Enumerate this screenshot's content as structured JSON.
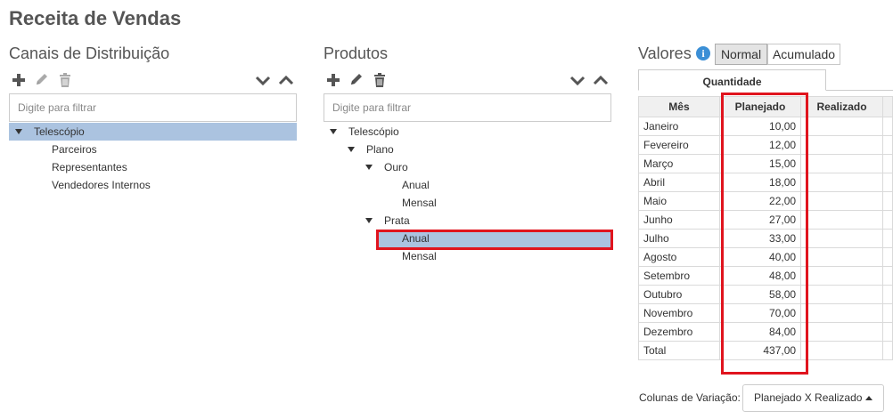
{
  "page": {
    "title": "Receita de Vendas"
  },
  "channels": {
    "title": "Canais de Distribuição",
    "filter_placeholder": "Digite para filtrar",
    "tree": [
      {
        "label": "Telescópio",
        "expanded": true,
        "selected": true
      },
      {
        "label": "Parceiros"
      },
      {
        "label": "Representantes"
      },
      {
        "label": "Vendedores Internos"
      }
    ]
  },
  "products": {
    "title": "Produtos",
    "filter_placeholder": "Digite para filtrar",
    "tree": [
      {
        "label": "Telescópio",
        "expanded": true
      },
      {
        "label": "Plano",
        "expanded": true
      },
      {
        "label": "Ouro",
        "expanded": true
      },
      {
        "label": "Anual"
      },
      {
        "label": "Mensal"
      },
      {
        "label": "Prata",
        "expanded": true
      },
      {
        "label": "Anual",
        "selected": true
      },
      {
        "label": "Mensal"
      }
    ]
  },
  "values": {
    "title": "Valores",
    "info_icon": "info-icon",
    "modes": [
      "Normal",
      "Acumulado"
    ],
    "active_mode": "Normal",
    "tab": "Quantidade",
    "columns": [
      "Mês",
      "Planejado",
      "Realizado"
    ],
    "rows": [
      {
        "month": "Janeiro",
        "planned": "10,00",
        "actual": ""
      },
      {
        "month": "Fevereiro",
        "planned": "12,00",
        "actual": ""
      },
      {
        "month": "Março",
        "planned": "15,00",
        "actual": ""
      },
      {
        "month": "Abril",
        "planned": "18,00",
        "actual": ""
      },
      {
        "month": "Maio",
        "planned": "22,00",
        "actual": ""
      },
      {
        "month": "Junho",
        "planned": "27,00",
        "actual": ""
      },
      {
        "month": "Julho",
        "planned": "33,00",
        "actual": ""
      },
      {
        "month": "Agosto",
        "planned": "40,00",
        "actual": ""
      },
      {
        "month": "Setembro",
        "planned": "48,00",
        "actual": ""
      },
      {
        "month": "Outubro",
        "planned": "58,00",
        "actual": ""
      },
      {
        "month": "Novembro",
        "planned": "70,00",
        "actual": ""
      },
      {
        "month": "Dezembro",
        "planned": "84,00",
        "actual": ""
      },
      {
        "month": "Total",
        "planned": "437,00",
        "actual": ""
      }
    ],
    "variation_label": "Colunas de Variação:",
    "variation_value": "Planejado X Realizado"
  },
  "colors": {
    "selection": "#abc3e0",
    "highlight": "#e0141e",
    "icon": "#555555"
  }
}
